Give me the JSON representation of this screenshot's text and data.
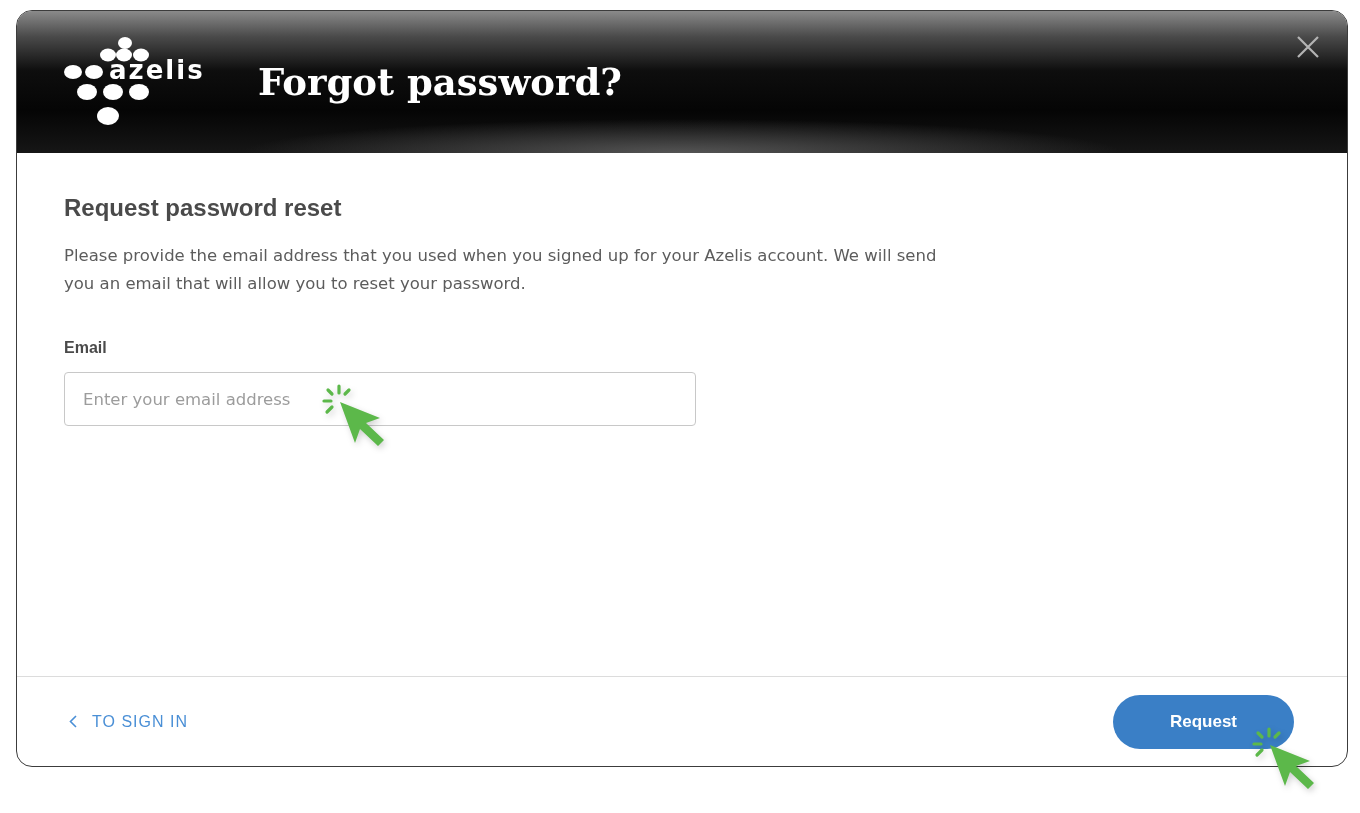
{
  "dialog": {
    "logo": {
      "text": "azelis"
    },
    "title": "Forgot password?"
  },
  "form": {
    "heading": "Request password reset",
    "description": "Please provide the email address that you used when you signed up for your Azelis account. We will send you an email that will allow you to reset your password.",
    "email": {
      "label": "Email",
      "placeholder": "Enter your email address"
    }
  },
  "footer": {
    "back_link": "TO SIGN IN",
    "submit_button": "Request"
  }
}
